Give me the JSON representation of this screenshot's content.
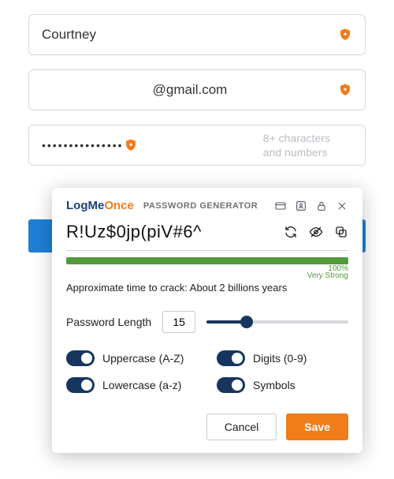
{
  "form": {
    "name_value": "Courtney",
    "email_value": "@gmail.com",
    "password_mask": "•••••••••••••••",
    "password_hint_line1": "8+ characters",
    "password_hint_line2": "and numbers"
  },
  "popup": {
    "brand_part1": "Log",
    "brand_part2": "Me",
    "brand_part3": "Once",
    "title": "PASSWORD GENERATOR",
    "generated_password": "R!Uz$0jp(piV#6^",
    "strength_percent": "100%",
    "strength_label": "Very Strong",
    "crack_time": "Approximate time to crack: About 2 billions years",
    "length_label": "Password Length",
    "length_value": "15",
    "toggles": {
      "uppercase": "Uppercase (A-Z)",
      "lowercase": "Lowercase (a-z)",
      "digits": "Digits (0-9)",
      "symbols": "Symbols"
    },
    "cancel_label": "Cancel",
    "save_label": "Save"
  },
  "colors": {
    "accent_orange": "#ef7d1a",
    "accent_blue": "#1f7fd6",
    "navy": "#17365f",
    "green": "#519a3c"
  }
}
